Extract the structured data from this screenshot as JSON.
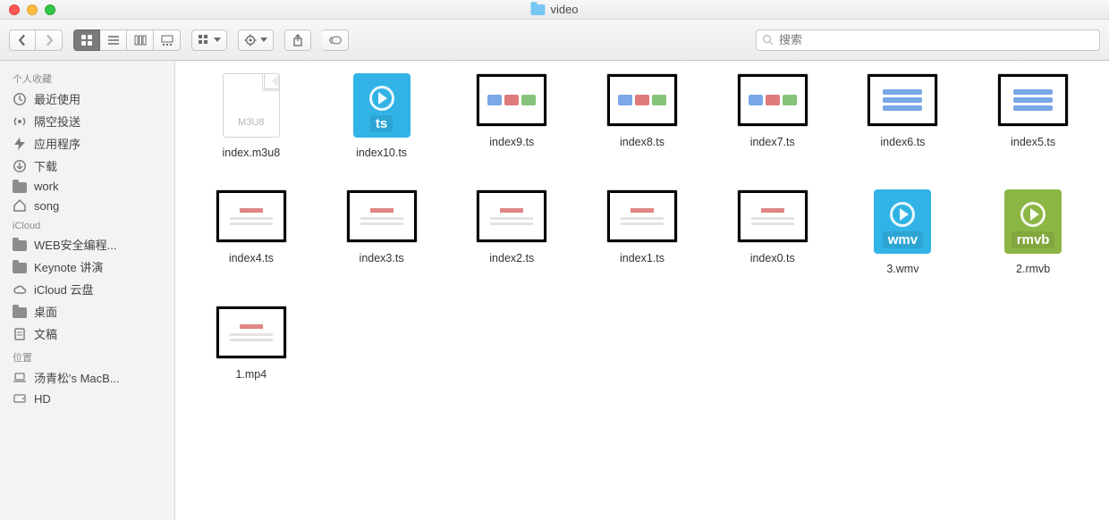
{
  "window": {
    "title": "video"
  },
  "search": {
    "placeholder": "搜索"
  },
  "sidebar": {
    "sections": [
      {
        "title": "个人收藏",
        "items": [
          {
            "icon": "clock",
            "label": "最近使用"
          },
          {
            "icon": "airdrop",
            "label": "隔空投送"
          },
          {
            "icon": "apps",
            "label": "应用程序"
          },
          {
            "icon": "download",
            "label": "下载"
          },
          {
            "icon": "folder",
            "label": "work"
          },
          {
            "icon": "home",
            "label": "song"
          }
        ]
      },
      {
        "title": "iCloud",
        "items": [
          {
            "icon": "folder",
            "label": "WEB安全编程..."
          },
          {
            "icon": "folder",
            "label": "Keynote 讲演"
          },
          {
            "icon": "cloud",
            "label": "iCloud 云盘"
          },
          {
            "icon": "folder",
            "label": "桌面"
          },
          {
            "icon": "doc",
            "label": "文稿"
          }
        ]
      },
      {
        "title": "位置",
        "items": [
          {
            "icon": "laptop",
            "label": "汤青松's MacB..."
          },
          {
            "icon": "disk",
            "label": "HD"
          }
        ]
      }
    ]
  },
  "files": [
    {
      "name": "index.m3u8",
      "kind": "m3u8",
      "badge": "M3U8"
    },
    {
      "name": "index10.ts",
      "kind": "ts",
      "badge": "ts"
    },
    {
      "name": "index9.ts",
      "kind": "videoA"
    },
    {
      "name": "index8.ts",
      "kind": "videoA"
    },
    {
      "name": "index7.ts",
      "kind": "videoA"
    },
    {
      "name": "index6.ts",
      "kind": "videoB"
    },
    {
      "name": "index5.ts",
      "kind": "videoB"
    },
    {
      "name": "index4.ts",
      "kind": "textish"
    },
    {
      "name": "index3.ts",
      "kind": "textish"
    },
    {
      "name": "index2.ts",
      "kind": "textish"
    },
    {
      "name": "index1.ts",
      "kind": "textish"
    },
    {
      "name": "index0.ts",
      "kind": "textish"
    },
    {
      "name": "3.wmv",
      "kind": "wmv",
      "badge": "wmv"
    },
    {
      "name": "2.rmvb",
      "kind": "rmvb",
      "badge": "rmvb"
    },
    {
      "name": "1.mp4",
      "kind": "textish"
    }
  ]
}
